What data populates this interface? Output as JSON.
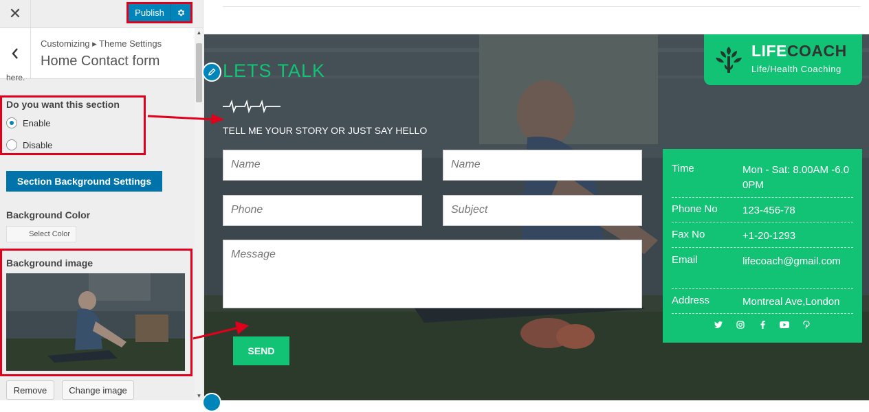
{
  "topbar": {
    "close_glyph": "✕",
    "publish_label": "Publish"
  },
  "section": {
    "breadcrumb": "Customizing ▸ Theme Settings",
    "title": "Home Contact form"
  },
  "sidebar": {
    "clipped_text": "here.",
    "section_toggle": {
      "label": "Do you want this section",
      "options": [
        {
          "label": "Enable",
          "checked": true
        },
        {
          "label": "Disable",
          "checked": false
        }
      ]
    },
    "bg_settings_label": "Section Background Settings",
    "bg_color": {
      "label": "Background Color",
      "button": "Select Color"
    },
    "bg_image": {
      "label": "Background image",
      "remove": "Remove",
      "change": "Change image"
    }
  },
  "preview": {
    "heading": "LETS TALK",
    "tagline": "TELL ME YOUR STORY OR JUST SAY HELLO",
    "form": {
      "name1": "Name",
      "name2": "Name",
      "phone": "Phone",
      "subject": "Subject",
      "message": "Message",
      "send": "SEND"
    },
    "logo": {
      "title_a": "LIFE",
      "title_b": "COACH",
      "subtitle": "Life/Health Coaching"
    },
    "info": [
      {
        "key": "Time",
        "value": "Mon - Sat: 8.00AM -6.00PM"
      },
      {
        "key": "Phone No",
        "value": "123-456-78"
      },
      {
        "key": "Fax No",
        "value": "+1-20-1293"
      },
      {
        "key": "Email",
        "value": "lifecoach@gmail.com"
      },
      {
        "key": "Address",
        "value": "Montreal Ave,London"
      }
    ],
    "socials": [
      "twitter-icon",
      "instagram-icon",
      "facebook-icon",
      "youtube-icon",
      "pinterest-icon"
    ]
  },
  "colors": {
    "accent": "#12c375",
    "admin_blue": "#0085ba",
    "annotation_red": "#e0001b"
  }
}
